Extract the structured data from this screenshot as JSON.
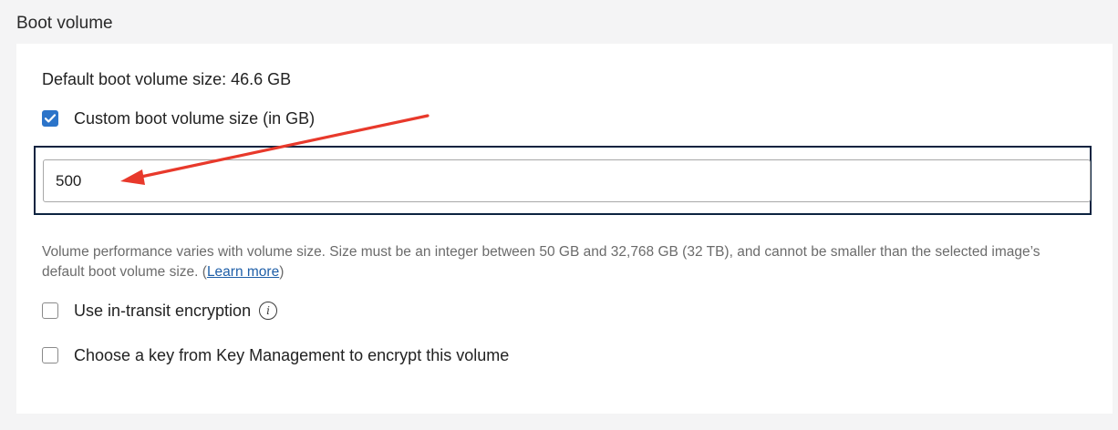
{
  "section": {
    "title": "Boot volume"
  },
  "boot_volume": {
    "default_size_text": "Default boot volume size: 46.6 GB",
    "custom_size": {
      "label": "Custom boot volume size (in GB)",
      "checked": true
    },
    "size_input": {
      "value": "500"
    },
    "help": {
      "text": "Volume performance varies with volume size. Size must be an integer between 50 GB and 32,768 GB (32 TB), and cannot be smaller than the selected image’s default boot volume size.",
      "open_paren": " (",
      "link_label": "Learn more",
      "close_paren": ")"
    },
    "in_transit_encryption": {
      "label": "Use in-transit encryption",
      "checked": false,
      "info_icon": "info-icon"
    },
    "key_management": {
      "label": "Choose a key from Key Management to encrypt this volume",
      "checked": false
    }
  },
  "colors": {
    "accent": "#2c74c9",
    "focus_frame": "#0c2340",
    "annotation_arrow": "#e8392b",
    "help_text": "#6b6b6b",
    "link": "#1f5fa8"
  }
}
